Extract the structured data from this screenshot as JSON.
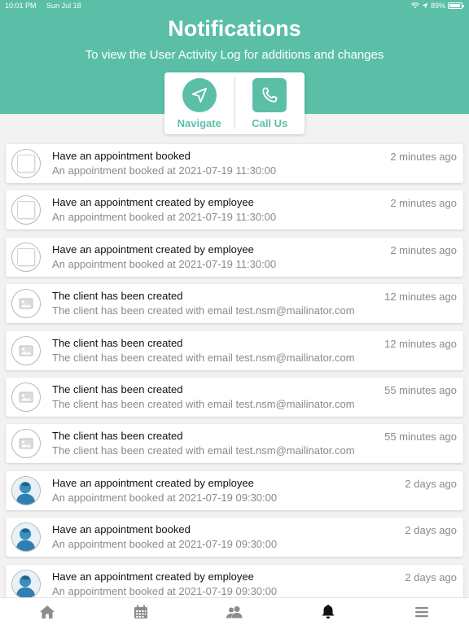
{
  "status_bar": {
    "time": "10:01 PM",
    "date": "Sun Jul 18",
    "battery": "89%"
  },
  "header": {
    "title": "Notifications",
    "subtitle": "To view the User Activity Log for additions and changes"
  },
  "actions": {
    "navigate_label": "Navigate",
    "call_label": "Call Us"
  },
  "colors": {
    "accent": "#5bbfa8",
    "tab_icon": "#8c8c8c",
    "tab_active": "#111111"
  },
  "notifications": [
    {
      "icon": "appointment-placeholder-icon",
      "title": "Have an appointment booked",
      "subtitle": "An appointment booked at 2021-07-19 11:30:00",
      "time": "2 minutes ago"
    },
    {
      "icon": "appointment-placeholder-icon",
      "title": "Have an appointment created by employee",
      "subtitle": "An appointment booked at 2021-07-19 11:30:00",
      "time": "2 minutes ago"
    },
    {
      "icon": "appointment-placeholder-icon",
      "title": "Have an appointment created by employee",
      "subtitle": "An appointment booked at 2021-07-19 11:30:00",
      "time": "2 minutes ago"
    },
    {
      "icon": "image-placeholder-icon",
      "title": "The client has been created",
      "subtitle": "The client has been created with email test.nsm@mailinator.com",
      "time": "12 minutes ago"
    },
    {
      "icon": "image-placeholder-icon",
      "title": "The client has been created",
      "subtitle": "The client has been created with email test.nsm@mailinator.com",
      "time": "12 minutes ago"
    },
    {
      "icon": "image-placeholder-icon",
      "title": "The client has been created",
      "subtitle": "The client has been created with email test.nsm@mailinator.com",
      "time": "55 minutes ago"
    },
    {
      "icon": "image-placeholder-icon",
      "title": "The client has been created",
      "subtitle": "The client has been created with email test.nsm@mailinator.com",
      "time": "55 minutes ago"
    },
    {
      "icon": "person-avatar-icon",
      "title": "Have an appointment created by employee",
      "subtitle": "An appointment booked at 2021-07-19 09:30:00",
      "time": "2 days ago"
    },
    {
      "icon": "person-avatar-icon",
      "title": "Have an appointment booked",
      "subtitle": "An appointment booked at 2021-07-19 09:30:00",
      "time": "2 days ago"
    },
    {
      "icon": "person-avatar-icon",
      "title": "Have an appointment created by employee",
      "subtitle": "An appointment booked at 2021-07-19 09:30:00",
      "time": "2 days ago"
    }
  ],
  "tabs": [
    {
      "icon": "home-icon",
      "active": false
    },
    {
      "icon": "calendar-icon",
      "active": false
    },
    {
      "icon": "users-icon",
      "active": false
    },
    {
      "icon": "bell-icon",
      "active": true
    },
    {
      "icon": "menu-icon",
      "active": false
    }
  ]
}
